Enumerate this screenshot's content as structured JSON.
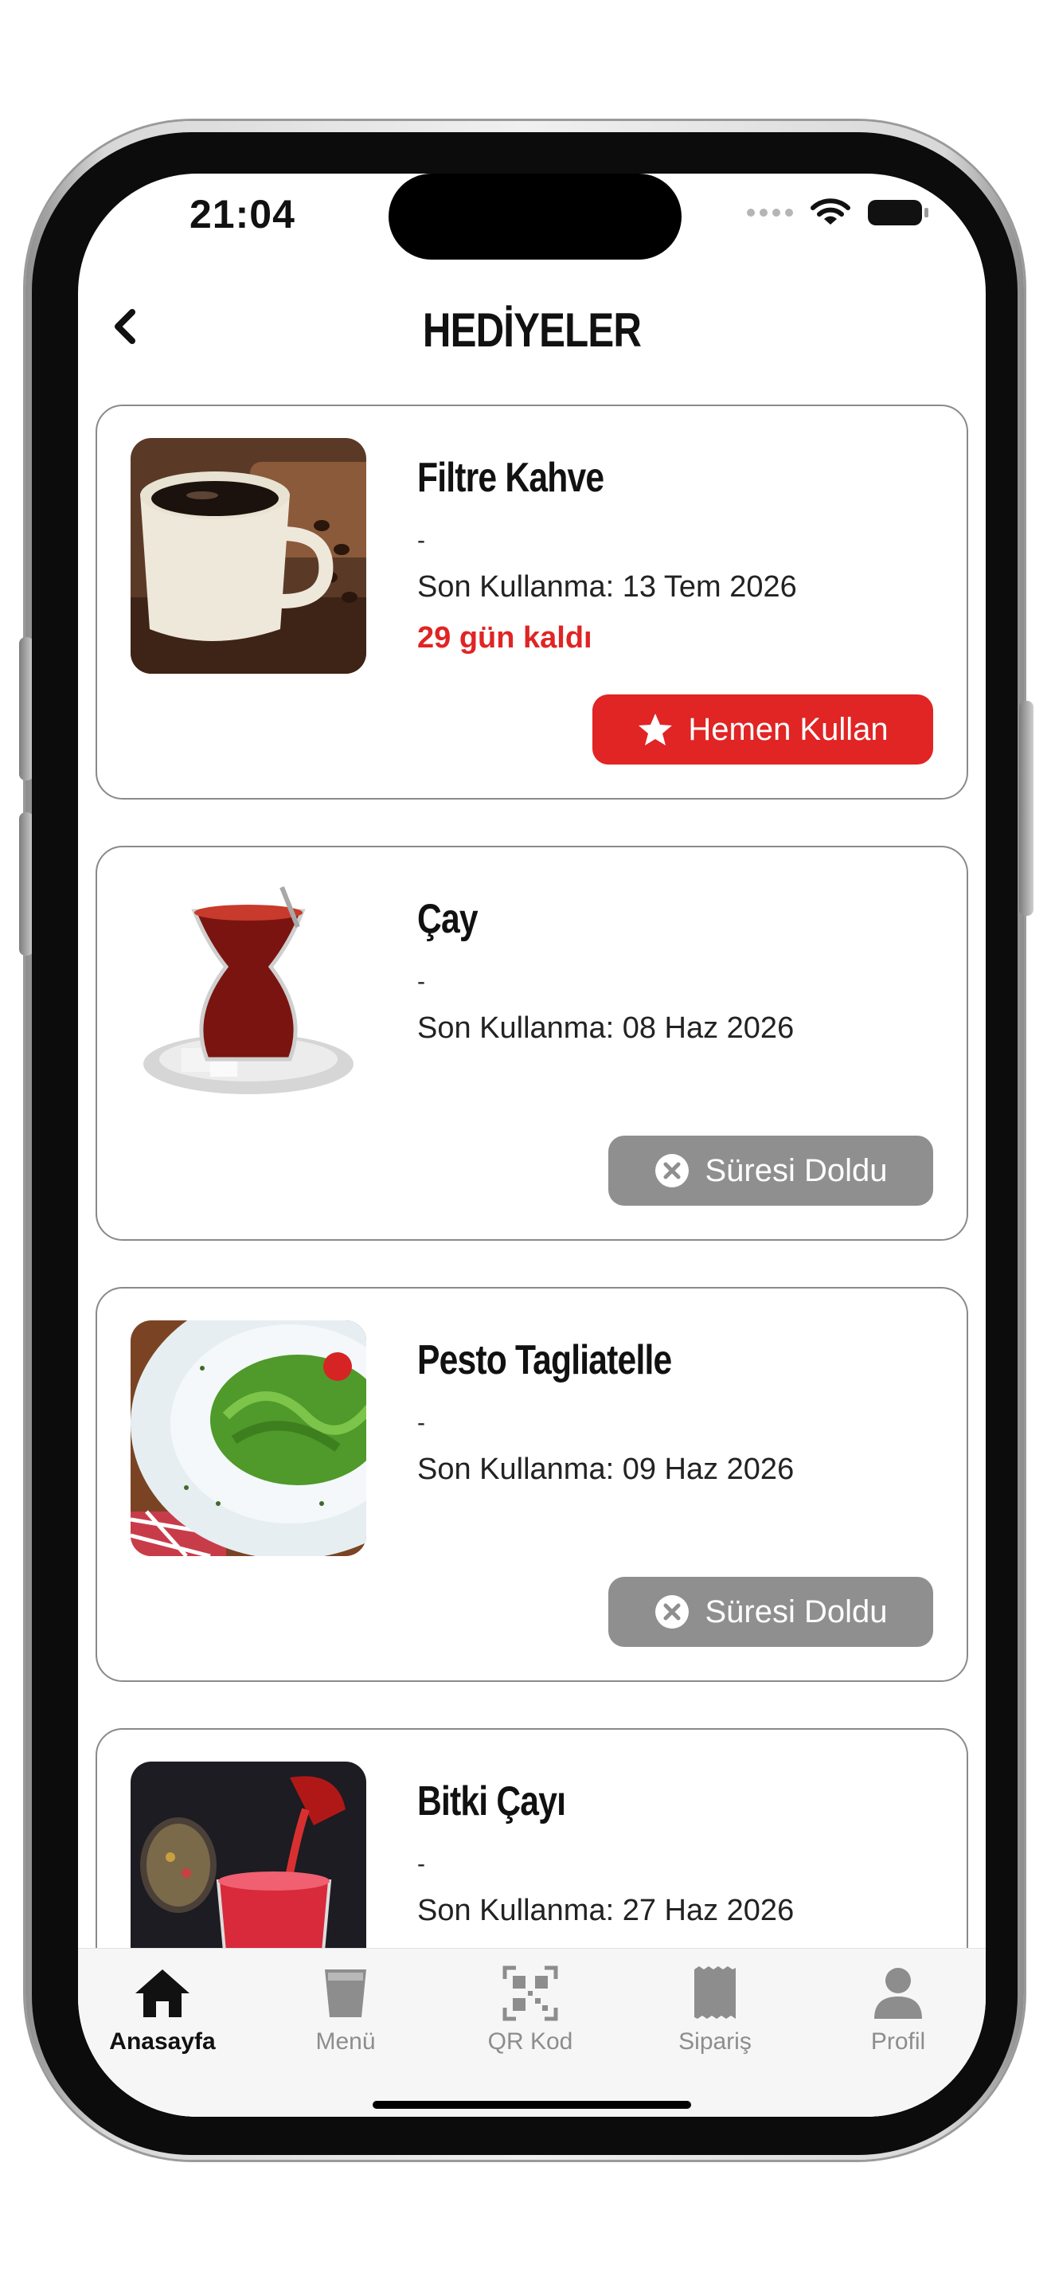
{
  "status_bar": {
    "time": "21:04"
  },
  "header": {
    "title": "HEDİYELER"
  },
  "gifts": [
    {
      "title": "Filtre Kahve",
      "description": "-",
      "expiry": "Son Kullanma: 13 Tem 2026",
      "remaining": "29 gün kaldı",
      "button_label": "Hemen Kullan",
      "status": "active",
      "image": "coffee-cup"
    },
    {
      "title": "Çay",
      "description": "-",
      "expiry": "Son Kullanma: 08 Haz 2026",
      "remaining": "",
      "button_label": "Süresi Doldu",
      "status": "expired",
      "image": "turkish-tea-glass"
    },
    {
      "title": "Pesto Tagliatelle",
      "description": "-",
      "expiry": "Son Kullanma: 09 Haz 2026",
      "remaining": "",
      "button_label": "Süresi Doldu",
      "status": "expired",
      "image": "pesto-pasta-plate"
    },
    {
      "title": "Bitki Çayı",
      "description": "-",
      "expiry": "Son Kullanma: 27 Haz 2026",
      "remaining": "",
      "button_label": "",
      "status": "unknown",
      "image": "herbal-tea"
    }
  ],
  "tab_bar": {
    "items": [
      {
        "label": "Anasayfa",
        "icon": "home-icon",
        "active": true
      },
      {
        "label": "Menü",
        "icon": "cup-icon",
        "active": false
      },
      {
        "label": "QR Kod",
        "icon": "qr-code-icon",
        "active": false
      },
      {
        "label": "Sipariş",
        "icon": "receipt-icon",
        "active": false
      },
      {
        "label": "Profil",
        "icon": "person-icon",
        "active": false
      }
    ]
  },
  "colors": {
    "accent": "#e12424",
    "expired": "#8f8f8f",
    "text": "#111111"
  }
}
